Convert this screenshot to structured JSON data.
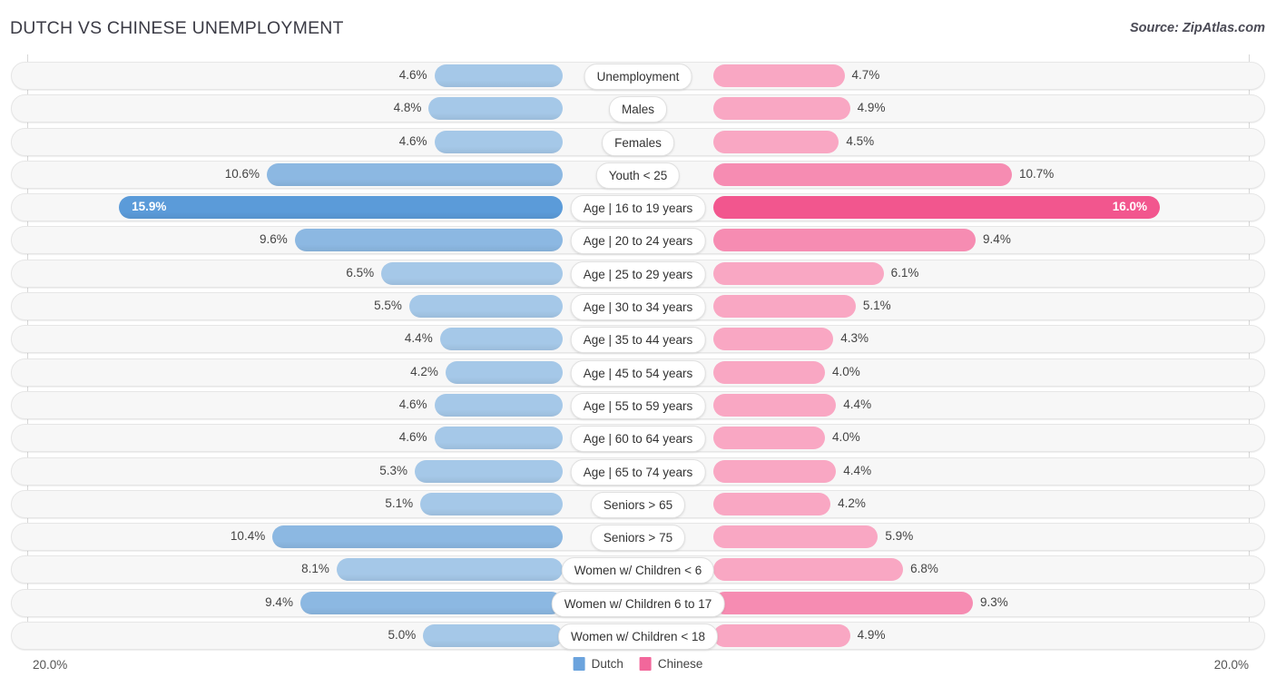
{
  "header": {
    "title": "DUTCH VS CHINESE UNEMPLOYMENT",
    "source": "Source: ZipAtlas.com"
  },
  "footer": {
    "axis_min_label": "20.0%",
    "axis_max_label": "20.0%",
    "legend": [
      {
        "label": "Dutch",
        "color": "#6ba3dd"
      },
      {
        "label": "Chinese",
        "color": "#f2679b"
      }
    ]
  },
  "colors": {
    "dutch_light": "#a5c8e8",
    "dutch_mid": "#8cb8e2",
    "dutch_dark": "#5b9bd9",
    "chinese_light": "#f9a7c3",
    "chinese_mid": "#f68cb2",
    "chinese_dark": "#f2568e",
    "track_bg": "#f7f7f7",
    "track_border": "#e6e6e6",
    "gridline": "#d7d7d7"
  },
  "chart_data": {
    "type": "bar",
    "title": "DUTCH VS CHINESE UNEMPLOYMENT",
    "subtitle": "",
    "xlabel": "",
    "ylabel": "",
    "orientation": "horizontal-diverging",
    "axis_max": 20.0,
    "axis_unit": "%",
    "grid": true,
    "legend_position": "bottom-center",
    "categories": [
      "Unemployment",
      "Males",
      "Females",
      "Youth < 25",
      "Age | 16 to 19 years",
      "Age | 20 to 24 years",
      "Age | 25 to 29 years",
      "Age | 30 to 34 years",
      "Age | 35 to 44 years",
      "Age | 45 to 54 years",
      "Age | 55 to 59 years",
      "Age | 60 to 64 years",
      "Age | 65 to 74 years",
      "Seniors > 65",
      "Seniors > 75",
      "Women w/ Children < 6",
      "Women w/ Children 6 to 17",
      "Women w/ Children < 18"
    ],
    "series": [
      {
        "name": "Dutch",
        "side": "left",
        "color": "#6ba3dd",
        "values": [
          4.6,
          4.8,
          4.6,
          10.6,
          15.9,
          9.6,
          6.5,
          5.5,
          4.4,
          4.2,
          4.6,
          4.6,
          5.3,
          5.1,
          10.4,
          8.1,
          9.4,
          5.0
        ]
      },
      {
        "name": "Chinese",
        "side": "right",
        "color": "#f2679b",
        "values": [
          4.7,
          4.9,
          4.5,
          10.7,
          16.0,
          9.4,
          6.1,
          5.1,
          4.3,
          4.0,
          4.4,
          4.0,
          4.4,
          4.2,
          5.9,
          6.8,
          9.3,
          4.9
        ]
      }
    ]
  },
  "rows": [
    {
      "label": "Unemployment",
      "left_value": 4.6,
      "left_text": "4.6%",
      "right_value": 4.7,
      "right_text": "4.7%"
    },
    {
      "label": "Males",
      "left_value": 4.8,
      "left_text": "4.8%",
      "right_value": 4.9,
      "right_text": "4.9%"
    },
    {
      "label": "Females",
      "left_value": 4.6,
      "left_text": "4.6%",
      "right_value": 4.5,
      "right_text": "4.5%"
    },
    {
      "label": "Youth < 25",
      "left_value": 10.6,
      "left_text": "10.6%",
      "right_value": 10.7,
      "right_text": "10.7%"
    },
    {
      "label": "Age | 16 to 19 years",
      "left_value": 15.9,
      "left_text": "15.9%",
      "right_value": 16.0,
      "right_text": "16.0%"
    },
    {
      "label": "Age | 20 to 24 years",
      "left_value": 9.6,
      "left_text": "9.6%",
      "right_value": 9.4,
      "right_text": "9.4%"
    },
    {
      "label": "Age | 25 to 29 years",
      "left_value": 6.5,
      "left_text": "6.5%",
      "right_value": 6.1,
      "right_text": "6.1%"
    },
    {
      "label": "Age | 30 to 34 years",
      "left_value": 5.5,
      "left_text": "5.5%",
      "right_value": 5.1,
      "right_text": "5.1%"
    },
    {
      "label": "Age | 35 to 44 years",
      "left_value": 4.4,
      "left_text": "4.4%",
      "right_value": 4.3,
      "right_text": "4.3%"
    },
    {
      "label": "Age | 45 to 54 years",
      "left_value": 4.2,
      "left_text": "4.2%",
      "right_value": 4.0,
      "right_text": "4.0%"
    },
    {
      "label": "Age | 55 to 59 years",
      "left_value": 4.6,
      "left_text": "4.6%",
      "right_value": 4.4,
      "right_text": "4.4%"
    },
    {
      "label": "Age | 60 to 64 years",
      "left_value": 4.6,
      "left_text": "4.6%",
      "right_value": 4.0,
      "right_text": "4.0%"
    },
    {
      "label": "Age | 65 to 74 years",
      "left_value": 5.3,
      "left_text": "5.3%",
      "right_value": 4.4,
      "right_text": "4.4%"
    },
    {
      "label": "Seniors > 65",
      "left_value": 5.1,
      "left_text": "5.1%",
      "right_value": 4.2,
      "right_text": "4.2%"
    },
    {
      "label": "Seniors > 75",
      "left_value": 10.4,
      "left_text": "10.4%",
      "right_value": 5.9,
      "right_text": "5.9%"
    },
    {
      "label": "Women w/ Children < 6",
      "left_value": 8.1,
      "left_text": "8.1%",
      "right_value": 6.8,
      "right_text": "6.8%"
    },
    {
      "label": "Women w/ Children 6 to 17",
      "left_value": 9.4,
      "left_text": "9.4%",
      "right_value": 9.3,
      "right_text": "9.3%"
    },
    {
      "label": "Women w/ Children < 18",
      "left_value": 5.0,
      "left_text": "5.0%",
      "right_value": 4.9,
      "right_text": "4.9%"
    }
  ]
}
